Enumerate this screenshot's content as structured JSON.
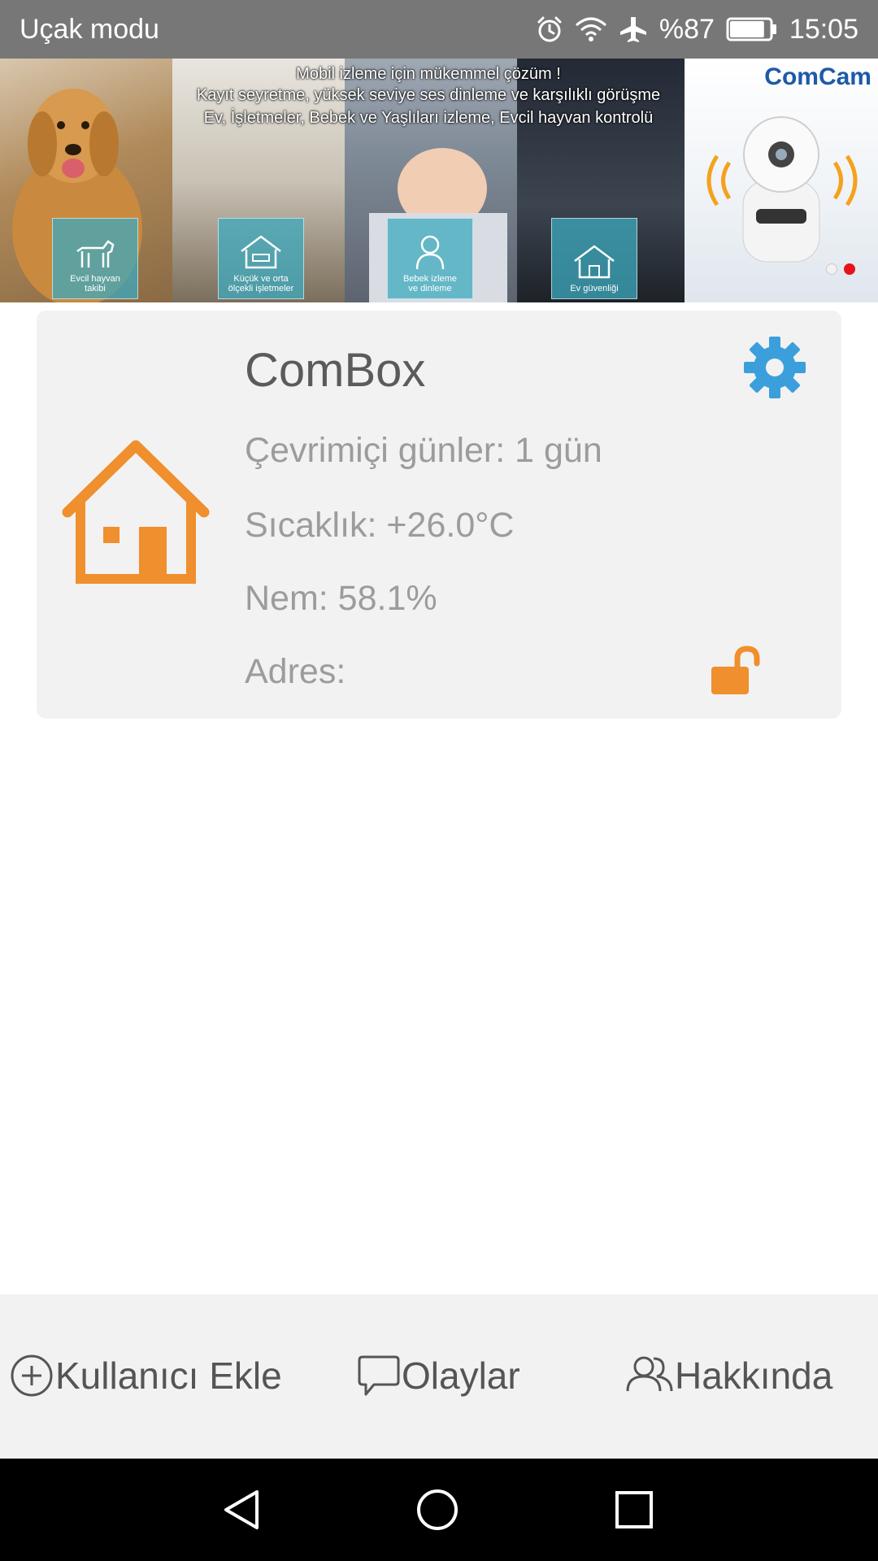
{
  "status_bar": {
    "mode_text": "Uçak modu",
    "battery_text": "%87",
    "battery_level": 0.87,
    "time": "15:05",
    "icons": [
      "alarm-icon",
      "wifi-icon",
      "airplane-icon",
      "battery-icon"
    ]
  },
  "banner": {
    "lines": [
      "Mobil izleme için mükemmel çözüm !",
      "Kayıt seyretme, yüksek seviye ses dinleme ve karşılıklı görüşme",
      "Ev, İşletmeler, Bebek ve Yaşlıları izleme, Evcil hayvan kontrolü"
    ],
    "features": [
      {
        "label": "Evcil hayvan\ntakibi",
        "icon": "dog-icon"
      },
      {
        "label": "Küçük ve orta\nölçekli işletmeler",
        "icon": "shop-icon"
      },
      {
        "label": "Bebek izleme\nve dinleme",
        "icon": "baby-icon"
      },
      {
        "label": "Ev güvenliği",
        "icon": "home-security-icon"
      }
    ],
    "brand": "ComCam",
    "page_count": 2,
    "active_page": 2
  },
  "device": {
    "name": "ComBox",
    "online_days": "Çevrimiçi günler: 1 gün",
    "temperature": "Sıcaklık: +26.0°C",
    "humidity": "Nem: 58.1%",
    "address": "Adres:",
    "icon": "house-icon",
    "lock_state": "unlocked",
    "colors": {
      "accent_orange": "#ef8f2d",
      "settings_blue": "#3b9fdc"
    }
  },
  "bottom_nav": {
    "add_user": "Kullanıcı Ekle",
    "events": "Olaylar",
    "about": "Hakkında"
  },
  "system_nav": [
    "back-icon",
    "home-icon",
    "recent-apps-icon"
  ]
}
